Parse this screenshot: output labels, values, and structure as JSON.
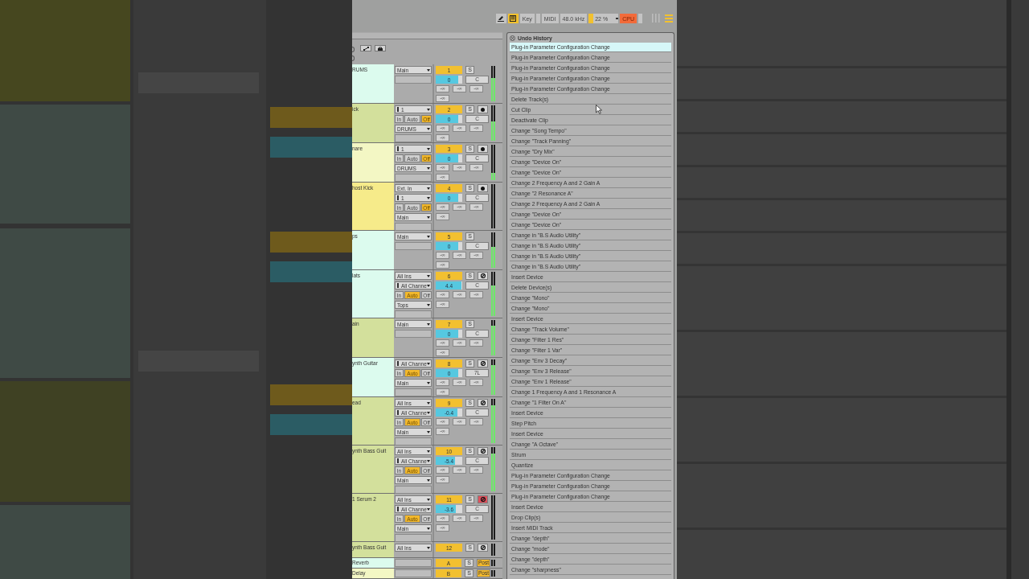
{
  "toolbar": {
    "draw_mode": {
      "on": false
    },
    "keys_mode": {
      "on": true
    },
    "key_button": {
      "label": "Key"
    },
    "midi_button": {
      "label": "MIDI"
    },
    "sample_rate": "48.0 kHz",
    "cpu": {
      "reading": "22 %",
      "level": 0.15
    },
    "overload": {
      "label": "CPU",
      "on": true
    }
  },
  "mixer": {
    "tracks": [
      {
        "name": "RUMS",
        "color": "#dcfbee",
        "io": [
          {
            "kind": "dropdown",
            "value": "Main"
          },
          {
            "kind": "empty"
          }
        ],
        "number": "1",
        "solo": "S",
        "volume": {
          "reading": "0",
          "level": 0.85
        },
        "pan": "C",
        "sends": [
          "-∞",
          "-∞",
          "-∞"
        ],
        "peak": "-∞",
        "meter": {
          "level": 0.65
        }
      },
      {
        "name": "ick",
        "color": "#d3e09c",
        "io": [
          {
            "kind": "channel",
            "value": "1"
          },
          {
            "kind": "monitor",
            "options": [
              {
                "label": "In",
                "selected": false
              },
              {
                "label": "Auto",
                "selected": false
              },
              {
                "label": "Off",
                "selected": true
              }
            ]
          },
          {
            "kind": "dropdown",
            "value": "DRUMS"
          },
          {
            "kind": "empty"
          }
        ],
        "number": "2",
        "solo": "S",
        "arm": {
          "kind": "record",
          "armed": false
        },
        "volume": {
          "reading": "0",
          "level": 0.85
        },
        "pan": "C",
        "sends": [
          "-∞",
          "-∞",
          "-∞"
        ],
        "peak": "-∞",
        "meter": {
          "level": 0.55
        }
      },
      {
        "name": "nare",
        "color": "#f3f7c4",
        "io": [
          {
            "kind": "channel",
            "value": "1"
          },
          {
            "kind": "monitor",
            "options": [
              {
                "label": "In",
                "selected": false
              },
              {
                "label": "Auto",
                "selected": false
              },
              {
                "label": "Off",
                "selected": true
              }
            ]
          },
          {
            "kind": "dropdown",
            "value": "DRUMS"
          },
          {
            "kind": "empty"
          }
        ],
        "number": "3",
        "solo": "S",
        "arm": {
          "kind": "record",
          "armed": false
        },
        "volume": {
          "reading": "0",
          "level": 0.85
        },
        "pan": "C",
        "sends": [
          "-∞",
          "-∞",
          "-∞"
        ],
        "peak": "-∞",
        "meter": {
          "level": 0.2
        }
      },
      {
        "name": "host Kick",
        "color": "#f6eb8a",
        "io": [
          {
            "kind": "dropdown",
            "value": "Ext. In"
          },
          {
            "kind": "channel",
            "value": "1"
          },
          {
            "kind": "monitor",
            "options": [
              {
                "label": "In",
                "selected": false
              },
              {
                "label": "Auto",
                "selected": false
              },
              {
                "label": "Off",
                "selected": true
              }
            ]
          },
          {
            "kind": "dropdown",
            "value": "Main"
          },
          {
            "kind": "empty"
          }
        ],
        "number": "4",
        "solo": "S",
        "arm": {
          "kind": "record",
          "armed": false
        },
        "volume": {
          "reading": "0",
          "level": 0.85
        },
        "pan": "C",
        "sends": [
          "-∞",
          "-∞",
          "-∞"
        ],
        "peak": "-∞",
        "meter": {
          "level": 0
        }
      },
      {
        "name": "ps",
        "color": "#dcfbee",
        "io": [
          {
            "kind": "dropdown",
            "value": "Main"
          },
          {
            "kind": "empty"
          }
        ],
        "number": "5",
        "solo": "S",
        "volume": {
          "reading": "0",
          "level": 0.85
        },
        "pan": "C",
        "sends": [
          "-∞",
          "-∞",
          "-∞"
        ],
        "peak": "-∞",
        "meter": {
          "level": 0.6
        }
      },
      {
        "name": "lats",
        "color": "#dcfbee",
        "io": [
          {
            "kind": "dropdown",
            "value": "All Ins"
          },
          {
            "kind": "channel",
            "value": "All Channe"
          },
          {
            "kind": "monitor",
            "options": [
              {
                "label": "In",
                "selected": false
              },
              {
                "label": "Auto",
                "selected": true
              },
              {
                "label": "Off",
                "selected": false
              }
            ]
          },
          {
            "kind": "dropdown",
            "value": "Tops"
          },
          {
            "kind": "empty"
          }
        ],
        "number": "6",
        "solo": "S",
        "arm": {
          "kind": "input",
          "armed": false
        },
        "volume": {
          "reading": "4.4",
          "level": 0.97
        },
        "pan": "C",
        "sends": [
          "-∞",
          "-∞",
          "-∞"
        ],
        "peak": "-∞",
        "meter": {
          "level": 0.7
        }
      },
      {
        "name": "ain",
        "color": "#d3e09c",
        "io": [
          {
            "kind": "dropdown",
            "value": "Main"
          },
          {
            "kind": "empty"
          }
        ],
        "number": "7",
        "solo": "S",
        "volume": {
          "reading": "0",
          "level": 0.85
        },
        "pan": "C",
        "sends": [
          "-∞",
          "-∞",
          "-∞"
        ],
        "peak": "-∞",
        "meter": {
          "level": 0.85
        }
      },
      {
        "name": "ynth Guitar",
        "color": "#dcfbee",
        "io": [
          {
            "kind": "channel",
            "value": "All Channe"
          },
          {
            "kind": "monitor",
            "options": [
              {
                "label": "In",
                "selected": false
              },
              {
                "label": "Auto",
                "selected": true
              },
              {
                "label": "Off",
                "selected": false
              }
            ]
          },
          {
            "kind": "dropdown",
            "value": "Main"
          },
          {
            "kind": "empty"
          }
        ],
        "number": "8",
        "solo": "S",
        "arm": {
          "kind": "input",
          "armed": false
        },
        "volume": {
          "reading": "0",
          "level": 0.85
        },
        "pan": "7L",
        "sends": [
          "-∞",
          "-∞",
          "-∞"
        ],
        "peak": "-∞",
        "meter": {
          "level": 0.85
        }
      },
      {
        "name": "ead",
        "color": "#d3e09c",
        "io": [
          {
            "kind": "dropdown",
            "value": "All Ins"
          },
          {
            "kind": "channel",
            "value": "All Channe"
          },
          {
            "kind": "monitor",
            "options": [
              {
                "label": "In",
                "selected": false
              },
              {
                "label": "Auto",
                "selected": true
              },
              {
                "label": "Off",
                "selected": false
              }
            ]
          },
          {
            "kind": "dropdown",
            "value": "Main"
          },
          {
            "kind": "empty"
          }
        ],
        "number": "9",
        "solo": "S",
        "arm": {
          "kind": "input",
          "armed": false
        },
        "volume": {
          "reading": "-0.4",
          "level": 0.83
        },
        "pan": "C",
        "sends": [
          "-∞",
          "-∞",
          "-∞"
        ],
        "peak": "-∞",
        "meter": {
          "level": 0.85
        }
      },
      {
        "name": "ynth Bass Guit",
        "color": "#d3e09c",
        "io": [
          {
            "kind": "dropdown",
            "value": "All Ins"
          },
          {
            "kind": "channel",
            "value": "All Channe"
          },
          {
            "kind": "monitor",
            "options": [
              {
                "label": "In",
                "selected": false
              },
              {
                "label": "Auto",
                "selected": true
              },
              {
                "label": "Off",
                "selected": false
              }
            ]
          },
          {
            "kind": "dropdown",
            "value": "Main"
          },
          {
            "kind": "empty"
          }
        ],
        "number": "10",
        "solo": "S",
        "arm": {
          "kind": "input",
          "armed": false
        },
        "volume": {
          "reading": "-5.4",
          "level": 0.72
        },
        "pan": "C",
        "sends": [
          "-∞",
          "-∞",
          "-∞"
        ],
        "peak": "-∞",
        "meter": {
          "level": 0.85
        }
      },
      {
        "name": "1 Serum 2",
        "color": "#d3e09c",
        "io": [
          {
            "kind": "dropdown",
            "value": "All Ins"
          },
          {
            "kind": "channel",
            "value": "All Channe"
          },
          {
            "kind": "monitor",
            "options": [
              {
                "label": "In",
                "selected": false
              },
              {
                "label": "Auto",
                "selected": true
              },
              {
                "label": "Off",
                "selected": false
              }
            ]
          },
          {
            "kind": "dropdown",
            "value": "Main"
          },
          {
            "kind": "empty"
          }
        ],
        "number": "11",
        "solo": "S",
        "arm": {
          "kind": "input",
          "armed": true
        },
        "volume": {
          "reading": "-3.6",
          "level": 0.75
        },
        "pan": "C",
        "sends": [
          "-∞",
          "-∞",
          "-∞"
        ],
        "peak": "-∞",
        "meter": {
          "level": 0
        }
      },
      {
        "name": "ynth Bass Guit",
        "color": "#d3e09c",
        "io": [
          {
            "kind": "dropdown",
            "value": "All Ins"
          }
        ],
        "number": "12",
        "solo": "S",
        "arm": {
          "kind": "input",
          "armed": false
        },
        "meter": {
          "level": 0
        }
      }
    ],
    "returns": [
      {
        "name": "Reverb",
        "color": "#dcfbee",
        "letter": "A",
        "solo": "S",
        "post": {
          "label": "Post",
          "on": true
        }
      },
      {
        "name": "Delay",
        "color": "#f3f7c4",
        "letter": "B",
        "solo": "S",
        "post": {
          "label": "Post",
          "on": true
        }
      }
    ]
  },
  "undo_history": {
    "title": "Undo History",
    "items": [
      {
        "label": "Plug-in Parameter Configuration Change",
        "selected": true
      },
      {
        "label": "Plug-in Parameter Configuration Change",
        "selected": false
      },
      {
        "label": "Plug-in Parameter Configuration Change",
        "selected": false
      },
      {
        "label": "Plug-in Parameter Configuration Change",
        "selected": false
      },
      {
        "label": "Plug-in Parameter Configuration Change",
        "selected": false
      },
      {
        "label": "Delete Track(s)",
        "selected": false
      },
      {
        "label": "Cut Clip",
        "selected": false
      },
      {
        "label": "Deactivate Clip",
        "selected": false
      },
      {
        "label": "Change \"Song Tempo\"",
        "selected": false
      },
      {
        "label": "Change \"Track Panning\"",
        "selected": false
      },
      {
        "label": "Change \"Dry Mix\"",
        "selected": false
      },
      {
        "label": "Change \"Device On\"",
        "selected": false
      },
      {
        "label": "Change \"Device On\"",
        "selected": false
      },
      {
        "label": "Change 2 Frequency A and 2 Gain A",
        "selected": false
      },
      {
        "label": "Change \"2 Resonance A\"",
        "selected": false
      },
      {
        "label": "Change 2 Frequency A and 2 Gain A",
        "selected": false
      },
      {
        "label": "Change \"Device On\"",
        "selected": false
      },
      {
        "label": "Change \"Device On\"",
        "selected": false
      },
      {
        "label": "Change in \"B.S Audio Utility\"",
        "selected": false
      },
      {
        "label": "Change in \"B.S Audio Utility\"",
        "selected": false
      },
      {
        "label": "Change in \"B.S Audio Utility\"",
        "selected": false
      },
      {
        "label": "Change in \"B.S Audio Utility\"",
        "selected": false
      },
      {
        "label": "Insert Device",
        "selected": false
      },
      {
        "label": "Delete Device(s)",
        "selected": false
      },
      {
        "label": "Change \"Mono\"",
        "selected": false
      },
      {
        "label": "Change \"Mono\"",
        "selected": false
      },
      {
        "label": "Insert Device",
        "selected": false
      },
      {
        "label": "Change \"Track Volume\"",
        "selected": false
      },
      {
        "label": "Change \"Filter 1 Res\"",
        "selected": false
      },
      {
        "label": "Change \"Filter 1 Var\"",
        "selected": false
      },
      {
        "label": "Change \"Env 3 Decay\"",
        "selected": false
      },
      {
        "label": "Change \"Env 3 Release\"",
        "selected": false
      },
      {
        "label": "Change \"Env 1 Release\"",
        "selected": false
      },
      {
        "label": "Change 1 Frequency A and 1 Resonance A",
        "selected": false
      },
      {
        "label": "Change \"1 Filter On A\"",
        "selected": false
      },
      {
        "label": "Insert Device",
        "selected": false
      },
      {
        "label": "Step Pitch",
        "selected": false
      },
      {
        "label": "Insert Device",
        "selected": false
      },
      {
        "label": "Change \"A Octave\"",
        "selected": false
      },
      {
        "label": "Strum",
        "selected": false
      },
      {
        "label": "Quantize",
        "selected": false
      },
      {
        "label": "Plug-in Parameter Configuration Change",
        "selected": false
      },
      {
        "label": "Plug-in Parameter Configuration Change",
        "selected": false
      },
      {
        "label": "Plug-in Parameter Configuration Change",
        "selected": false
      },
      {
        "label": "Insert Device",
        "selected": false
      },
      {
        "label": "Drop Clip(s)",
        "selected": false
      },
      {
        "label": "Insert MIDI Track",
        "selected": false
      },
      {
        "label": "Change \"depth\"",
        "selected": false
      },
      {
        "label": "Change \"mode\"",
        "selected": false
      },
      {
        "label": "Change \"depth\"",
        "selected": false
      },
      {
        "label": "Change \"sharpness\"",
        "selected": false
      }
    ]
  }
}
